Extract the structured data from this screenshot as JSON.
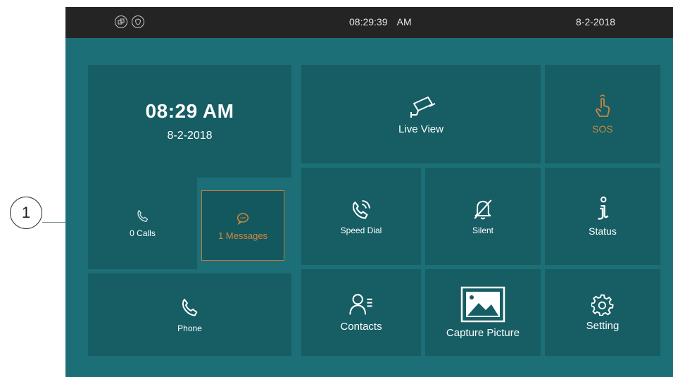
{
  "callout": {
    "number": "1"
  },
  "status_bar": {
    "icons": [
      "window-icon",
      "shield-icon"
    ],
    "time": "08:29:39 AM",
    "date": "8-2-2018"
  },
  "clock": {
    "time": "08:29 AM",
    "date": "8-2-2018"
  },
  "calls": {
    "label": "0 Calls",
    "icon": "phone-icon"
  },
  "messages": {
    "label": "1 Messages",
    "icon": "chat-bubble-icon"
  },
  "phone": {
    "label": "Phone",
    "icon": "phone-icon"
  },
  "tiles": {
    "live_view": {
      "label": "Live View",
      "icon": "camera-icon"
    },
    "sos": {
      "label": "SOS",
      "icon": "hand-tap-icon"
    },
    "speed_dial": {
      "label": "Speed Dial",
      "icon": "phone-ringing-icon"
    },
    "silent": {
      "label": "Silent",
      "icon": "bell-muted-icon"
    },
    "status": {
      "label": "Status",
      "icon": "info-icon"
    },
    "contacts": {
      "label": "Contacts",
      "icon": "contacts-icon"
    },
    "capture_picture": {
      "label": "Capture Picture",
      "icon": "picture-icon"
    },
    "setting": {
      "label": "Setting",
      "icon": "gear-icon"
    }
  },
  "colors": {
    "screen_bg": "#1c6f76",
    "tile_bg": "#165d64",
    "status_bar_bg": "#242424",
    "accent_orange": "#c9873f"
  }
}
